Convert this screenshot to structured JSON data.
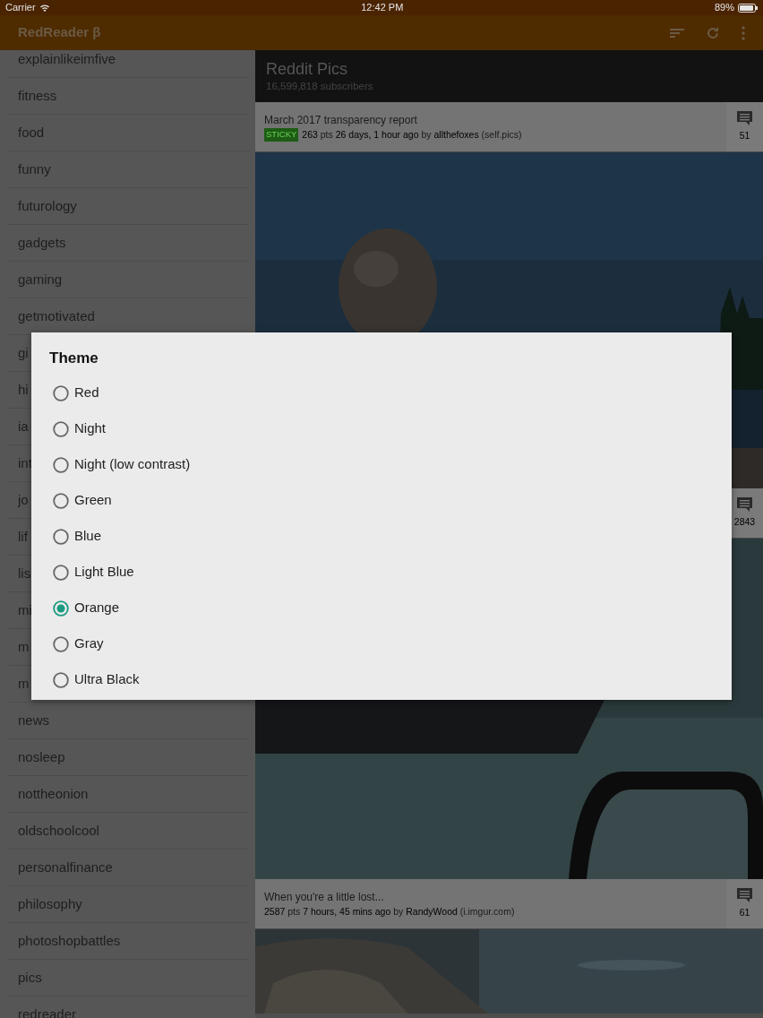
{
  "status_bar": {
    "carrier": "Carrier",
    "time": "12:42 PM",
    "battery": "89%"
  },
  "app_bar": {
    "title": "RedReader β"
  },
  "sidebar": {
    "items": [
      {
        "label": "explainlikeimfive"
      },
      {
        "label": "fitness"
      },
      {
        "label": "food"
      },
      {
        "label": "funny"
      },
      {
        "label": "futurology"
      },
      {
        "label": "gadgets"
      },
      {
        "label": "gaming"
      },
      {
        "label": "getmotivated"
      },
      {
        "label": "gi"
      },
      {
        "label": "hi"
      },
      {
        "label": "ia"
      },
      {
        "label": "int"
      },
      {
        "label": "jo"
      },
      {
        "label": "lif"
      },
      {
        "label": "lis"
      },
      {
        "label": "mi"
      },
      {
        "label": "m"
      },
      {
        "label": "m"
      },
      {
        "label": "news"
      },
      {
        "label": "nosleep"
      },
      {
        "label": "nottheonion"
      },
      {
        "label": "oldschoolcool"
      },
      {
        "label": "personalfinance"
      },
      {
        "label": "philosophy"
      },
      {
        "label": "photoshopbattles"
      },
      {
        "label": "pics"
      },
      {
        "label": "redreader"
      }
    ]
  },
  "subreddit": {
    "title": "Reddit Pics",
    "subscribers": "16,599,818 subscribers"
  },
  "posts": [
    {
      "title": "March 2017 transparency report",
      "tag": "STICKY",
      "points": "263",
      "points_label": "pts",
      "age": "26 days, 1 hour ago",
      "by_label": "by",
      "author": "allthefoxes",
      "domain": "(self.pics)",
      "comments": "51"
    },
    {
      "comments": "2843"
    },
    {
      "title": "When you're a little lost...",
      "points": "2587",
      "points_label": "pts",
      "age": "7 hours, 45 mins ago",
      "by_label": "by",
      "author": "RandyWood",
      "domain": "(i.imgur.com)",
      "comments": "61"
    }
  ],
  "dialog": {
    "title": "Theme",
    "options": [
      {
        "label": "Red",
        "selected": false
      },
      {
        "label": "Night",
        "selected": false
      },
      {
        "label": "Night (low contrast)",
        "selected": false
      },
      {
        "label": "Green",
        "selected": false
      },
      {
        "label": "Blue",
        "selected": false
      },
      {
        "label": "Light Blue",
        "selected": false
      },
      {
        "label": "Orange",
        "selected": true
      },
      {
        "label": "Gray",
        "selected": false
      },
      {
        "label": "Ultra Black",
        "selected": false
      }
    ]
  }
}
